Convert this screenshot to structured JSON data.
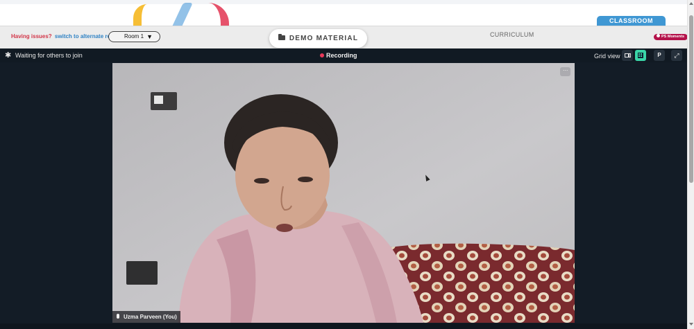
{
  "header": {
    "classroom_tab": "CLASSROOM",
    "issues_prefix": "Having issues?",
    "issues_link": "switch to alternate room",
    "room_select": {
      "selected": "Room 1"
    },
    "demo_material": "DEMO MATERIAL",
    "curriculum": "CURRICULUM",
    "ps_moments": "PS Moments"
  },
  "call": {
    "status": "Waiting for others to join",
    "recording": "Recording",
    "view_label": "Grid view",
    "participant_button": "P",
    "participant": {
      "name": "Uzma Parveen (You)"
    }
  },
  "icons": {
    "settings": "gear-icon",
    "folder": "folder-icon",
    "view_sidebar": "sidebar-view-icon",
    "view_grid": "grid-view-icon",
    "fullscreen": "fullscreen-icon",
    "more": "more-options-icon",
    "mic": "microphone-icon"
  },
  "colors": {
    "accent_green": "#3ad6a8",
    "classroom_blue": "#3f97d3",
    "recording_red": "#e8395a",
    "issues_red": "#d23447",
    "link_blue": "#2f82c4",
    "call_bg": "#131c26",
    "ps_moments": "#b4124a"
  }
}
